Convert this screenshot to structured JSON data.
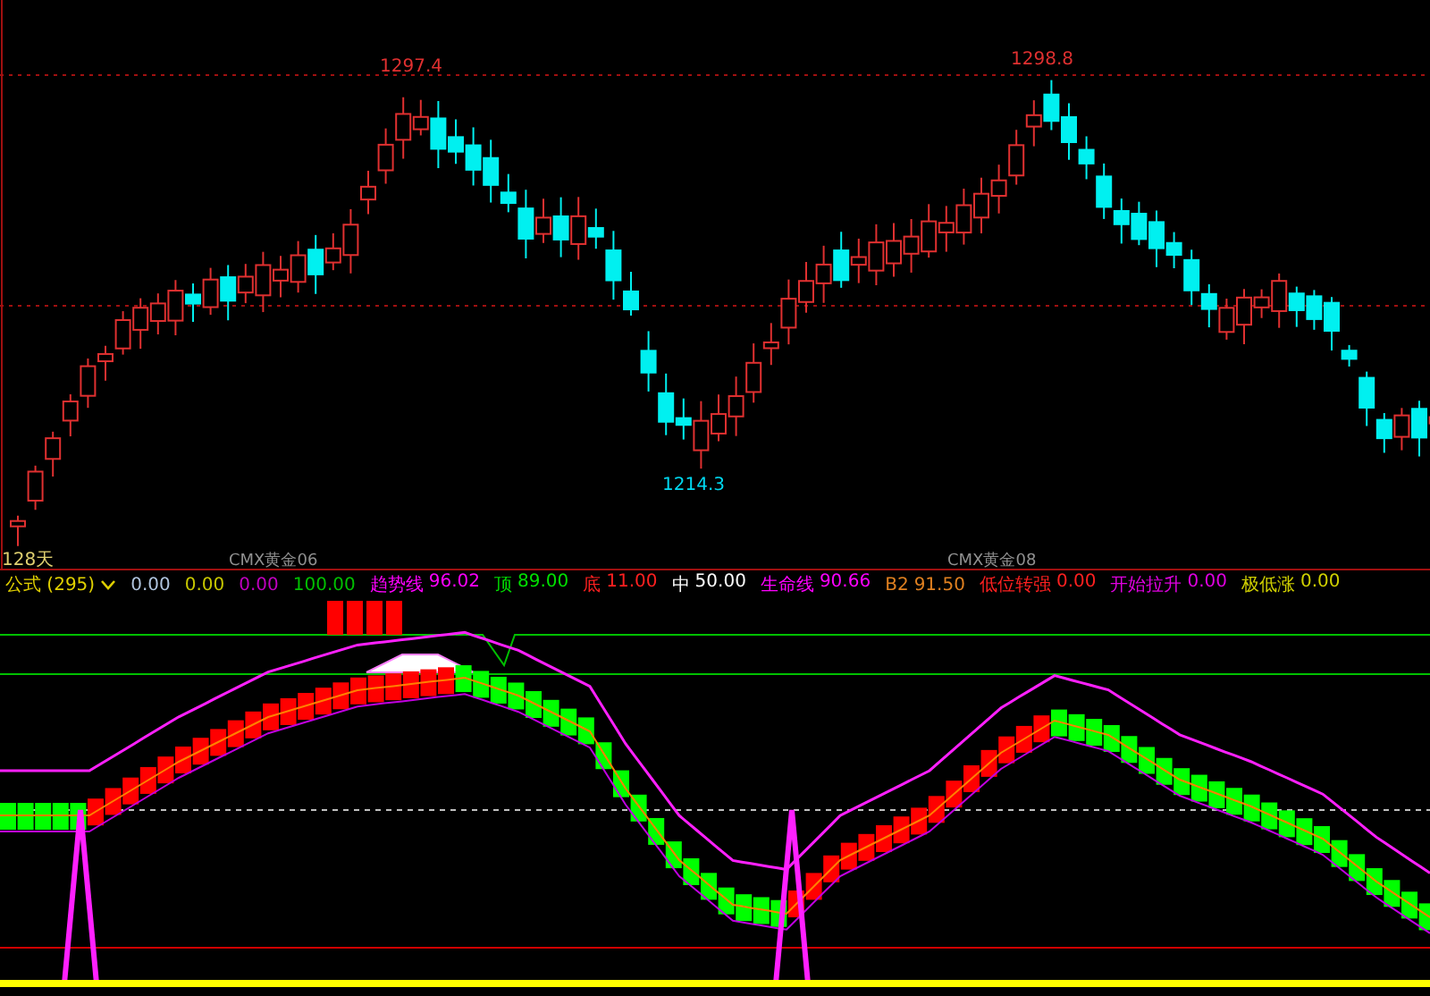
{
  "price_chart": {
    "high_labels": [
      {
        "text": "1297.4",
        "color": "#e03030"
      },
      {
        "text": "1298.8",
        "color": "#e03030"
      }
    ],
    "low_label": {
      "text": "1214.3",
      "color": "#00d8f0"
    },
    "period_label": "128天",
    "contract_labels": [
      "CMX黄金06",
      "CMX黄金08"
    ]
  },
  "indicator_bar": {
    "formula": "公式 (295)",
    "items": [
      {
        "value": "0.00",
        "color": "#b0c4de"
      },
      {
        "value": "0.00",
        "color": "#c8c800"
      },
      {
        "value": "0.00",
        "color": "#c000c0"
      },
      {
        "value": "100.00",
        "color": "#00c000"
      },
      {
        "label": "趋势线",
        "value": "96.02",
        "color": "#ff00ff"
      },
      {
        "label": "顶",
        "value": "89.00",
        "color": "#00e000"
      },
      {
        "label": "底",
        "value": "11.00",
        "color": "#ff2020"
      },
      {
        "label": "中",
        "value": "50.00",
        "color": "#ffffff"
      },
      {
        "label": "生命线",
        "value": "90.66",
        "color": "#ff00ff"
      },
      {
        "label": "B2",
        "value": "91.50",
        "color": "#e08020"
      },
      {
        "label": "低位转强",
        "value": "0.00",
        "color": "#ff2020"
      },
      {
        "label": "开始拉升",
        "value": "0.00",
        "color": "#e000e0"
      },
      {
        "label": "极低涨",
        "value": "0.00",
        "color": "#d0d000"
      }
    ]
  }
}
